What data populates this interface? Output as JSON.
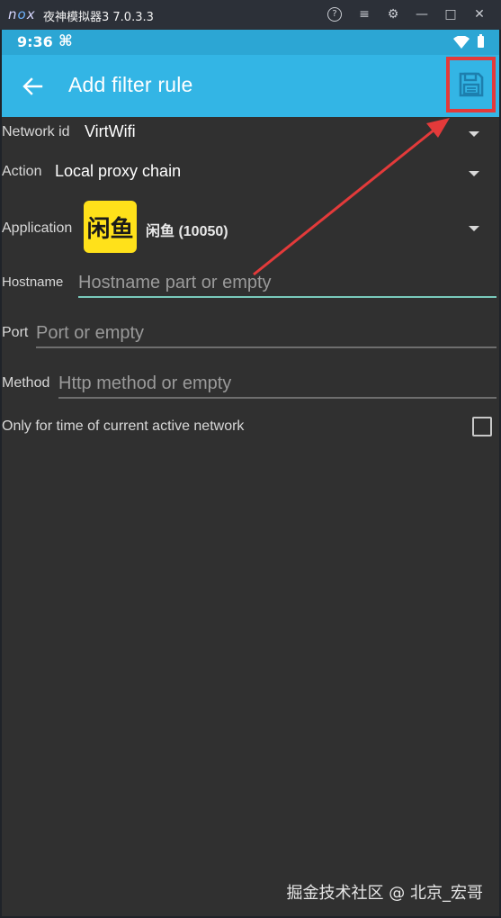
{
  "window": {
    "logo": "nox",
    "title": "夜神模拟器3 7.0.3.3",
    "controls": {
      "help": "?",
      "menu": "≡",
      "settings": "⚙",
      "minimize": "—",
      "maximize": "□",
      "close": "✕"
    }
  },
  "statusbar": {
    "time": "9:36",
    "notification": "⌘"
  },
  "toolbar": {
    "title": "Add filter rule"
  },
  "form": {
    "network_id": {
      "label": "Network id",
      "value": "VirtWifi"
    },
    "action": {
      "label": "Action",
      "value": "Local proxy chain"
    },
    "application": {
      "label": "Application",
      "icon_text": "闲鱼",
      "value": "闲鱼 (10050)"
    },
    "hostname": {
      "label": "Hostname",
      "placeholder": "Hostname part or empty",
      "value": ""
    },
    "port": {
      "label": "Port",
      "placeholder": "Port or empty",
      "value": ""
    },
    "method": {
      "label": "Method",
      "placeholder": "Http method or empty",
      "value": ""
    },
    "only_active": {
      "label": "Only for time of current active network",
      "checked": false
    }
  },
  "watermark": "掘金技术社区 @ 北京_宏哥",
  "colors": {
    "toolbar": "#33b5e5",
    "statusbar": "#2ca6d4",
    "background": "#303030",
    "highlight": "#e33a3a",
    "active_underline": "#79c9bc",
    "app_icon": "#ffe11a"
  },
  "icons": {
    "back": "arrow-left-icon",
    "save": "floppy-disk-icon",
    "dropdown": "triangle-down-icon"
  }
}
